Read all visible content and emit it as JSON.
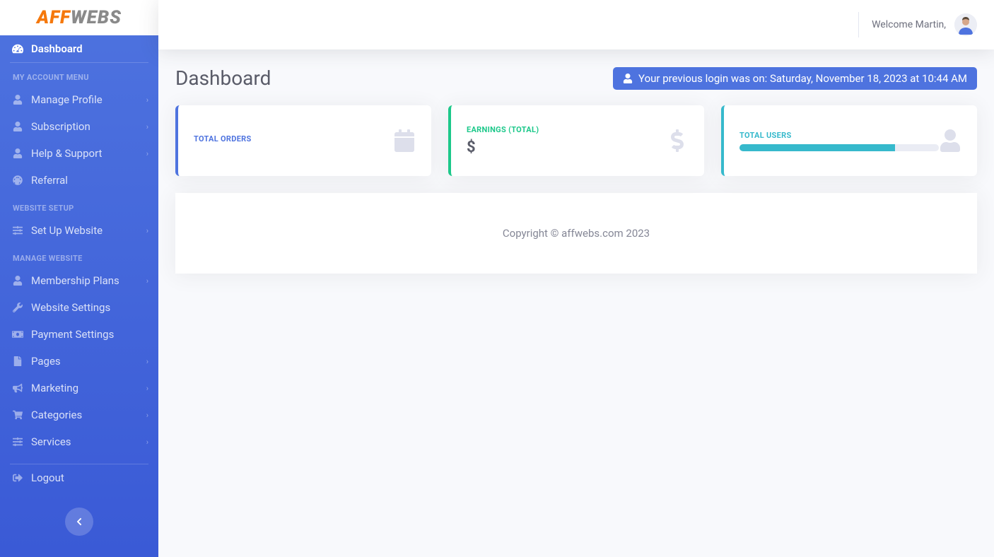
{
  "brand": {
    "part1": "AFF",
    "part2": "WEBS"
  },
  "topbar": {
    "welcome": "Welcome Martin,"
  },
  "sidebar": {
    "dashboard": "Dashboard",
    "sections": {
      "account_heading": "MY ACCOUNT MENU",
      "setup_heading": "WEBSITE SETUP",
      "manage_heading": "MANAGE WEBSITE"
    },
    "items": {
      "manage_profile": "Manage Profile",
      "subscription": "Subscription",
      "help_support": "Help & Support",
      "referral": "Referral",
      "setup_website": "Set Up Website",
      "membership_plans": "Membership Plans",
      "website_settings": "Website Settings",
      "payment_settings": "Payment Settings",
      "pages": "Pages",
      "marketing": "Marketing",
      "categories": "Categories",
      "services": "Services",
      "logout": "Logout"
    }
  },
  "page": {
    "title": "Dashboard",
    "login_alert": "Your previous login was on: Saturday, November 18, 2023 at 10:44 AM"
  },
  "cards": {
    "orders": {
      "label": "TOTAL ORDERS",
      "value": ""
    },
    "earnings": {
      "label": "EARNINGS (TOTAL)",
      "value": "$"
    },
    "users": {
      "label": "TOTAL USERS",
      "progress_percent": 78
    }
  },
  "footer": {
    "copyright": "Copyright © affwebs.com 2023"
  }
}
